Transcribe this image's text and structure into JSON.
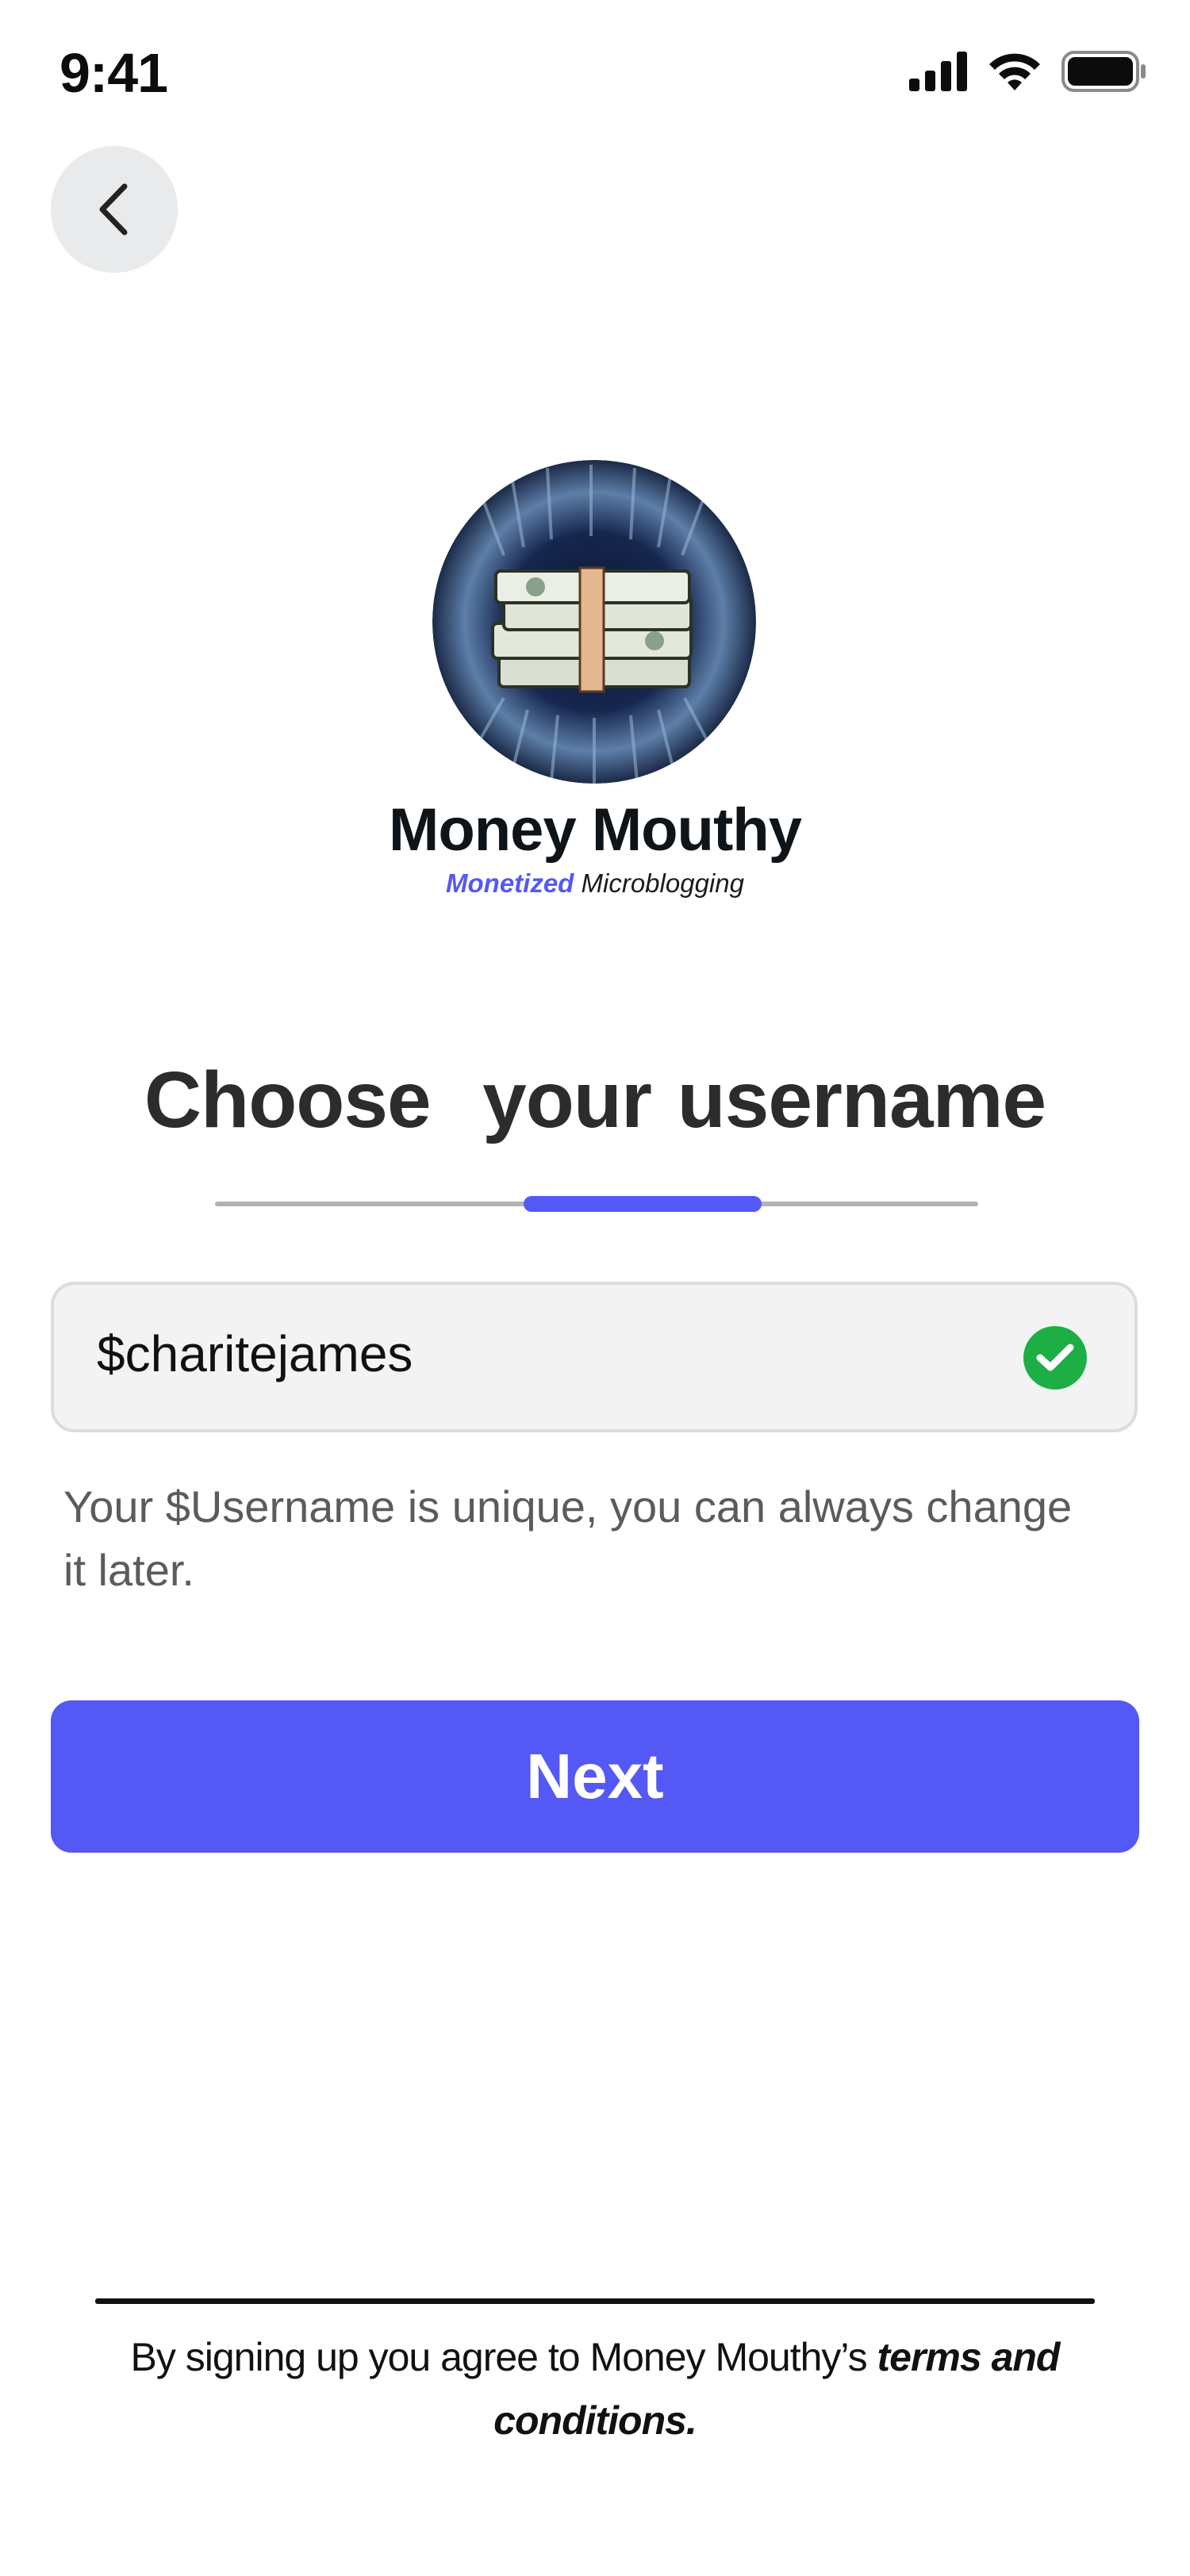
{
  "status_bar": {
    "time": "9:41",
    "icons": [
      "cellular-signal-icon",
      "wifi-icon",
      "battery-icon"
    ]
  },
  "nav": {
    "back_icon": "chevron-left-icon"
  },
  "brand": {
    "name": "Money Mouthy",
    "tagline_highlight": "Monetized",
    "tagline_rest": " Microblogging",
    "accent_color": "#5458f4"
  },
  "page": {
    "title": "Choose  your username",
    "progress_fraction_start": 0.4,
    "progress_fraction_end": 0.72
  },
  "username_field": {
    "value": "$charitejames",
    "status_icon": "check-circle-icon",
    "status_color": "#1dae45"
  },
  "helper_text": "Your $Username is unique, you can always change it later.",
  "next_button": {
    "label": "Next",
    "color": "#5458f4"
  },
  "footer": {
    "prefix": "By signing up you agree to Money Mouthy’s ",
    "link": "terms and conditions."
  }
}
